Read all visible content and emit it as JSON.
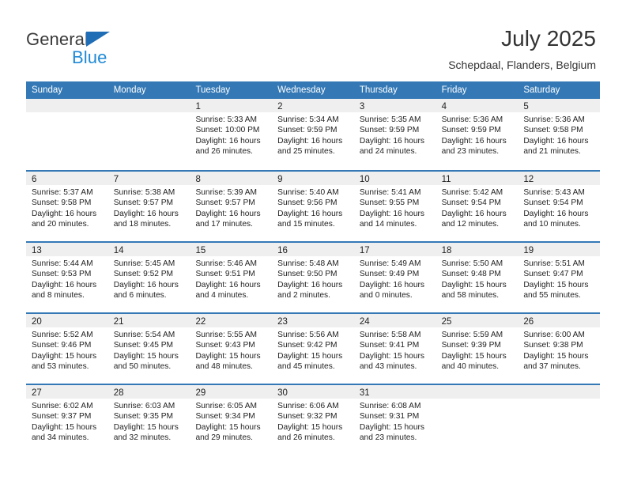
{
  "brand": {
    "name_part1": "General",
    "name_part2": "Blue",
    "triangle_color": "#1f6db5",
    "blue_color": "#1f8ad6"
  },
  "header": {
    "title": "July 2025",
    "subtitle": "Schepdaal, Flanders, Belgium"
  },
  "theme": {
    "header_blue": "#3479b6",
    "band_gray": "#efefef",
    "text": "#222222"
  },
  "weekdays": [
    "Sunday",
    "Monday",
    "Tuesday",
    "Wednesday",
    "Thursday",
    "Friday",
    "Saturday"
  ],
  "weeks": [
    [
      {
        "day": "",
        "sunrise": "",
        "sunset": "",
        "daylight_line1": "",
        "daylight_line2": ""
      },
      {
        "day": "",
        "sunrise": "",
        "sunset": "",
        "daylight_line1": "",
        "daylight_line2": ""
      },
      {
        "day": "1",
        "sunrise": "Sunrise: 5:33 AM",
        "sunset": "Sunset: 10:00 PM",
        "daylight_line1": "Daylight: 16 hours",
        "daylight_line2": "and 26 minutes."
      },
      {
        "day": "2",
        "sunrise": "Sunrise: 5:34 AM",
        "sunset": "Sunset: 9:59 PM",
        "daylight_line1": "Daylight: 16 hours",
        "daylight_line2": "and 25 minutes."
      },
      {
        "day": "3",
        "sunrise": "Sunrise: 5:35 AM",
        "sunset": "Sunset: 9:59 PM",
        "daylight_line1": "Daylight: 16 hours",
        "daylight_line2": "and 24 minutes."
      },
      {
        "day": "4",
        "sunrise": "Sunrise: 5:36 AM",
        "sunset": "Sunset: 9:59 PM",
        "daylight_line1": "Daylight: 16 hours",
        "daylight_line2": "and 23 minutes."
      },
      {
        "day": "5",
        "sunrise": "Sunrise: 5:36 AM",
        "sunset": "Sunset: 9:58 PM",
        "daylight_line1": "Daylight: 16 hours",
        "daylight_line2": "and 21 minutes."
      }
    ],
    [
      {
        "day": "6",
        "sunrise": "Sunrise: 5:37 AM",
        "sunset": "Sunset: 9:58 PM",
        "daylight_line1": "Daylight: 16 hours",
        "daylight_line2": "and 20 minutes."
      },
      {
        "day": "7",
        "sunrise": "Sunrise: 5:38 AM",
        "sunset": "Sunset: 9:57 PM",
        "daylight_line1": "Daylight: 16 hours",
        "daylight_line2": "and 18 minutes."
      },
      {
        "day": "8",
        "sunrise": "Sunrise: 5:39 AM",
        "sunset": "Sunset: 9:57 PM",
        "daylight_line1": "Daylight: 16 hours",
        "daylight_line2": "and 17 minutes."
      },
      {
        "day": "9",
        "sunrise": "Sunrise: 5:40 AM",
        "sunset": "Sunset: 9:56 PM",
        "daylight_line1": "Daylight: 16 hours",
        "daylight_line2": "and 15 minutes."
      },
      {
        "day": "10",
        "sunrise": "Sunrise: 5:41 AM",
        "sunset": "Sunset: 9:55 PM",
        "daylight_line1": "Daylight: 16 hours",
        "daylight_line2": "and 14 minutes."
      },
      {
        "day": "11",
        "sunrise": "Sunrise: 5:42 AM",
        "sunset": "Sunset: 9:54 PM",
        "daylight_line1": "Daylight: 16 hours",
        "daylight_line2": "and 12 minutes."
      },
      {
        "day": "12",
        "sunrise": "Sunrise: 5:43 AM",
        "sunset": "Sunset: 9:54 PM",
        "daylight_line1": "Daylight: 16 hours",
        "daylight_line2": "and 10 minutes."
      }
    ],
    [
      {
        "day": "13",
        "sunrise": "Sunrise: 5:44 AM",
        "sunset": "Sunset: 9:53 PM",
        "daylight_line1": "Daylight: 16 hours",
        "daylight_line2": "and 8 minutes."
      },
      {
        "day": "14",
        "sunrise": "Sunrise: 5:45 AM",
        "sunset": "Sunset: 9:52 PM",
        "daylight_line1": "Daylight: 16 hours",
        "daylight_line2": "and 6 minutes."
      },
      {
        "day": "15",
        "sunrise": "Sunrise: 5:46 AM",
        "sunset": "Sunset: 9:51 PM",
        "daylight_line1": "Daylight: 16 hours",
        "daylight_line2": "and 4 minutes."
      },
      {
        "day": "16",
        "sunrise": "Sunrise: 5:48 AM",
        "sunset": "Sunset: 9:50 PM",
        "daylight_line1": "Daylight: 16 hours",
        "daylight_line2": "and 2 minutes."
      },
      {
        "day": "17",
        "sunrise": "Sunrise: 5:49 AM",
        "sunset": "Sunset: 9:49 PM",
        "daylight_line1": "Daylight: 16 hours",
        "daylight_line2": "and 0 minutes."
      },
      {
        "day": "18",
        "sunrise": "Sunrise: 5:50 AM",
        "sunset": "Sunset: 9:48 PM",
        "daylight_line1": "Daylight: 15 hours",
        "daylight_line2": "and 58 minutes."
      },
      {
        "day": "19",
        "sunrise": "Sunrise: 5:51 AM",
        "sunset": "Sunset: 9:47 PM",
        "daylight_line1": "Daylight: 15 hours",
        "daylight_line2": "and 55 minutes."
      }
    ],
    [
      {
        "day": "20",
        "sunrise": "Sunrise: 5:52 AM",
        "sunset": "Sunset: 9:46 PM",
        "daylight_line1": "Daylight: 15 hours",
        "daylight_line2": "and 53 minutes."
      },
      {
        "day": "21",
        "sunrise": "Sunrise: 5:54 AM",
        "sunset": "Sunset: 9:45 PM",
        "daylight_line1": "Daylight: 15 hours",
        "daylight_line2": "and 50 minutes."
      },
      {
        "day": "22",
        "sunrise": "Sunrise: 5:55 AM",
        "sunset": "Sunset: 9:43 PM",
        "daylight_line1": "Daylight: 15 hours",
        "daylight_line2": "and 48 minutes."
      },
      {
        "day": "23",
        "sunrise": "Sunrise: 5:56 AM",
        "sunset": "Sunset: 9:42 PM",
        "daylight_line1": "Daylight: 15 hours",
        "daylight_line2": "and 45 minutes."
      },
      {
        "day": "24",
        "sunrise": "Sunrise: 5:58 AM",
        "sunset": "Sunset: 9:41 PM",
        "daylight_line1": "Daylight: 15 hours",
        "daylight_line2": "and 43 minutes."
      },
      {
        "day": "25",
        "sunrise": "Sunrise: 5:59 AM",
        "sunset": "Sunset: 9:39 PM",
        "daylight_line1": "Daylight: 15 hours",
        "daylight_line2": "and 40 minutes."
      },
      {
        "day": "26",
        "sunrise": "Sunrise: 6:00 AM",
        "sunset": "Sunset: 9:38 PM",
        "daylight_line1": "Daylight: 15 hours",
        "daylight_line2": "and 37 minutes."
      }
    ],
    [
      {
        "day": "27",
        "sunrise": "Sunrise: 6:02 AM",
        "sunset": "Sunset: 9:37 PM",
        "daylight_line1": "Daylight: 15 hours",
        "daylight_line2": "and 34 minutes."
      },
      {
        "day": "28",
        "sunrise": "Sunrise: 6:03 AM",
        "sunset": "Sunset: 9:35 PM",
        "daylight_line1": "Daylight: 15 hours",
        "daylight_line2": "and 32 minutes."
      },
      {
        "day": "29",
        "sunrise": "Sunrise: 6:05 AM",
        "sunset": "Sunset: 9:34 PM",
        "daylight_line1": "Daylight: 15 hours",
        "daylight_line2": "and 29 minutes."
      },
      {
        "day": "30",
        "sunrise": "Sunrise: 6:06 AM",
        "sunset": "Sunset: 9:32 PM",
        "daylight_line1": "Daylight: 15 hours",
        "daylight_line2": "and 26 minutes."
      },
      {
        "day": "31",
        "sunrise": "Sunrise: 6:08 AM",
        "sunset": "Sunset: 9:31 PM",
        "daylight_line1": "Daylight: 15 hours",
        "daylight_line2": "and 23 minutes."
      },
      {
        "day": "",
        "sunrise": "",
        "sunset": "",
        "daylight_line1": "",
        "daylight_line2": ""
      },
      {
        "day": "",
        "sunrise": "",
        "sunset": "",
        "daylight_line1": "",
        "daylight_line2": ""
      }
    ]
  ]
}
